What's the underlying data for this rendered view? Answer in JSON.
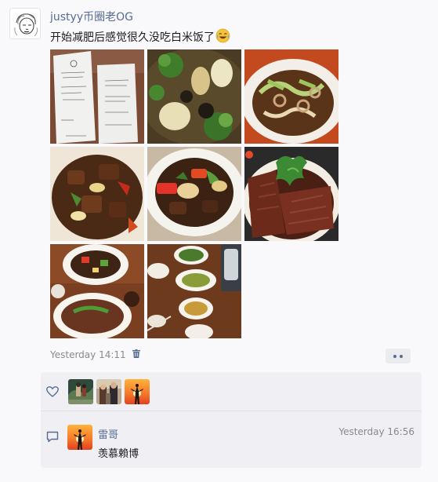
{
  "post": {
    "username": "justyy币圈老OG",
    "text": "开始减肥后感觉很久没吃白米饭了",
    "emoji": "face-with-tears-of-joy",
    "photos": [
      {
        "name": "receipt-photo"
      },
      {
        "name": "broccoli-dish-photo"
      },
      {
        "name": "squid-dish-photo"
      },
      {
        "name": "beef-pepper-dish-photo"
      },
      {
        "name": "beef-stirfry-dish-photo"
      },
      {
        "name": "sliced-beef-dish-photo"
      },
      {
        "name": "table-dishes-photo"
      },
      {
        "name": "table-overview-photo"
      }
    ],
    "timestamp": "Yesterday 14:11",
    "likes": [
      {
        "name": "like-avatar-1"
      },
      {
        "name": "like-avatar-2"
      },
      {
        "name": "like-avatar-3"
      }
    ],
    "comment": {
      "author": "雷哥",
      "time": "Yesterday 16:56",
      "text": "羡慕賴博"
    }
  },
  "colors": {
    "link": "#576b95",
    "meta": "#8a8a8a",
    "panel": "#f0f0f4",
    "background": "#f9f9fb"
  }
}
